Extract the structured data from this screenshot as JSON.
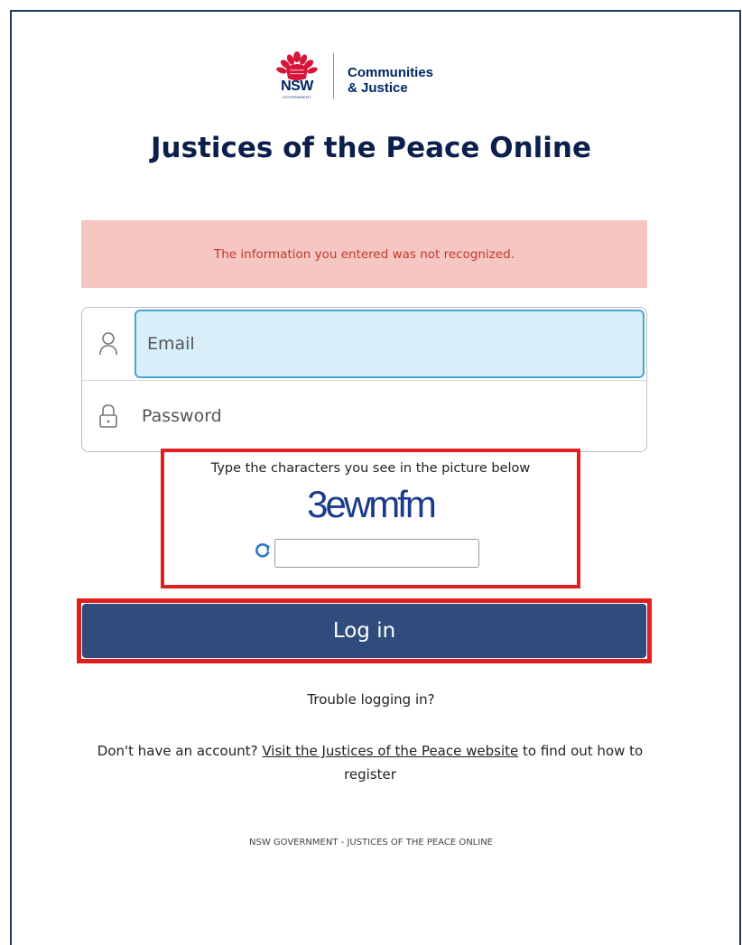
{
  "logo": {
    "nsw": "NSW",
    "government": "GOVERNMENT",
    "org_line1": "Communities",
    "org_line2": "& Justice"
  },
  "page_title": "Justices of the Peace Online",
  "error_message": "The information you entered was not recognized.",
  "login": {
    "email_placeholder": "Email",
    "password_placeholder": "Password",
    "user_icon": "user-icon",
    "lock_icon": "lock-icon"
  },
  "captcha": {
    "label": "Type the characters you see in the picture below",
    "image_text": "3ewmfm",
    "refresh_icon": "refresh-icon",
    "input_value": ""
  },
  "login_button_label": "Log in",
  "trouble_link": "Trouble logging in?",
  "register": {
    "prefix": "Don't have an account?",
    "link_text": "Visit the Justices of the Peace website",
    "suffix": "to find out how to register"
  },
  "footer": "NSW GOVERNMENT - JUSTICES OF THE PEACE ONLINE",
  "colors": {
    "brand_navy": "#002664",
    "button": "#2f4c7c",
    "error_bg": "#f6c6c3",
    "error_text": "#c0392b",
    "highlight": "#e02020",
    "email_focus": "#d8eef8"
  }
}
